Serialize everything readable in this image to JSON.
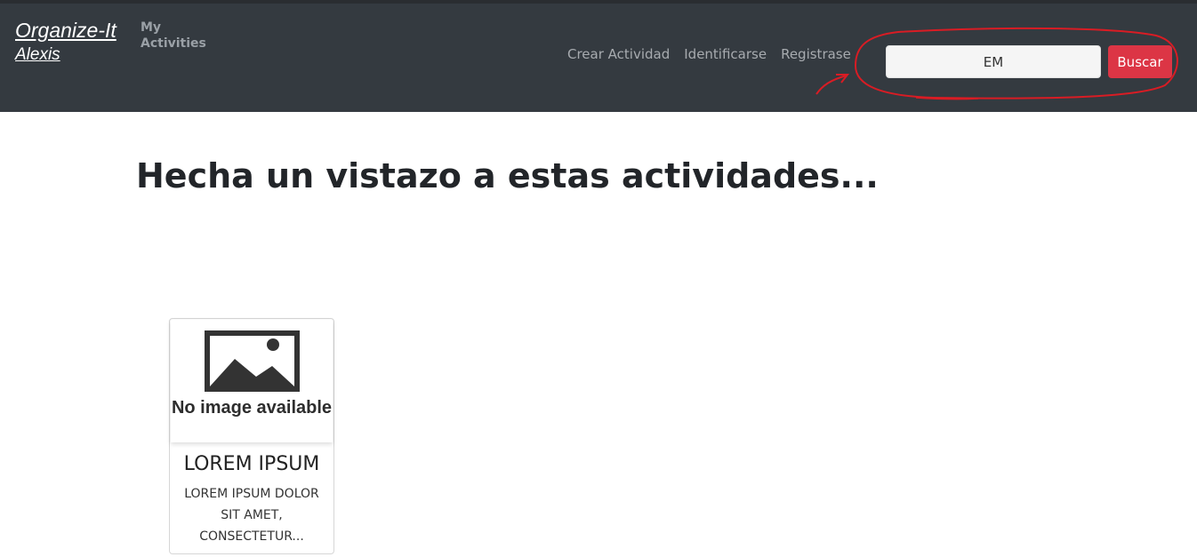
{
  "navbar": {
    "brand_title": "Organize-It",
    "brand_user": "Alexis",
    "my_activities": "My Activities",
    "links": [
      "Crear Actividad",
      "Identificarse",
      "Registrase"
    ],
    "search": {
      "value": "EM",
      "button_label": "Buscar"
    }
  },
  "main": {
    "heading": "Hecha un vistazo a estas actividades...",
    "cards": [
      {
        "image_text": "No image available",
        "title": "LOREM IPSUM",
        "text": "LOREM IPSUM DOLOR SIT AMET, CONSECTETUR..."
      }
    ]
  },
  "colors": {
    "navbar_bg": "#343a40",
    "button_red": "#dc3545",
    "annotation_red": "#d91c24"
  }
}
